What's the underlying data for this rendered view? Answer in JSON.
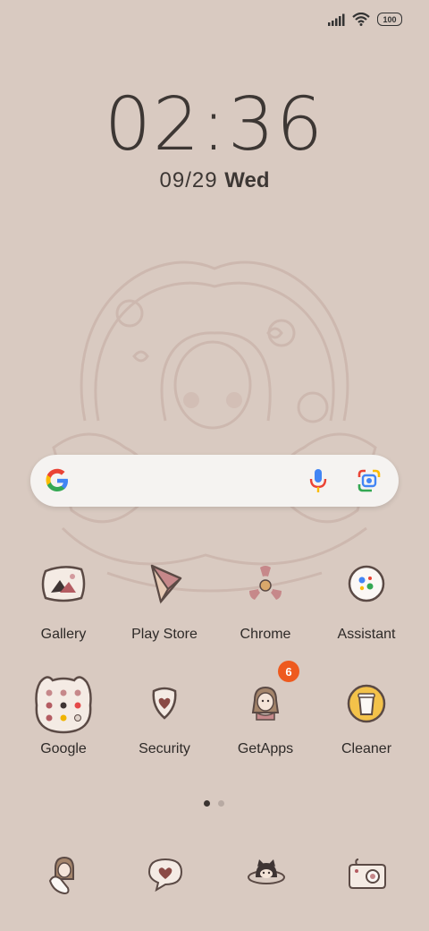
{
  "status_bar": {
    "battery": "100",
    "icons": [
      "signal-icon",
      "wifi-icon",
      "battery-icon"
    ]
  },
  "lockclock": {
    "time": "02:36",
    "date": "09/29",
    "weekday": "Wed"
  },
  "search": {
    "icons": [
      "google-g-icon",
      "microphone-icon",
      "google-lens-icon"
    ]
  },
  "apps": [
    {
      "label": "Gallery"
    },
    {
      "label": "Play Store"
    },
    {
      "label": "Chrome"
    },
    {
      "label": "Assistant"
    },
    {
      "label": "Google"
    },
    {
      "label": "Security"
    },
    {
      "label": "GetApps",
      "badge": "6"
    },
    {
      "label": "Cleaner"
    }
  ],
  "pager": {
    "pages": 2,
    "active": 1
  },
  "dock": {
    "icons": [
      "phone-girl-icon",
      "messages-heart-icon",
      "browser-cat-icon",
      "camera-icon"
    ]
  },
  "colors": {
    "background": "#d9cac1",
    "badge": "#ee5a1e",
    "line_art": "#c8b1a7"
  }
}
